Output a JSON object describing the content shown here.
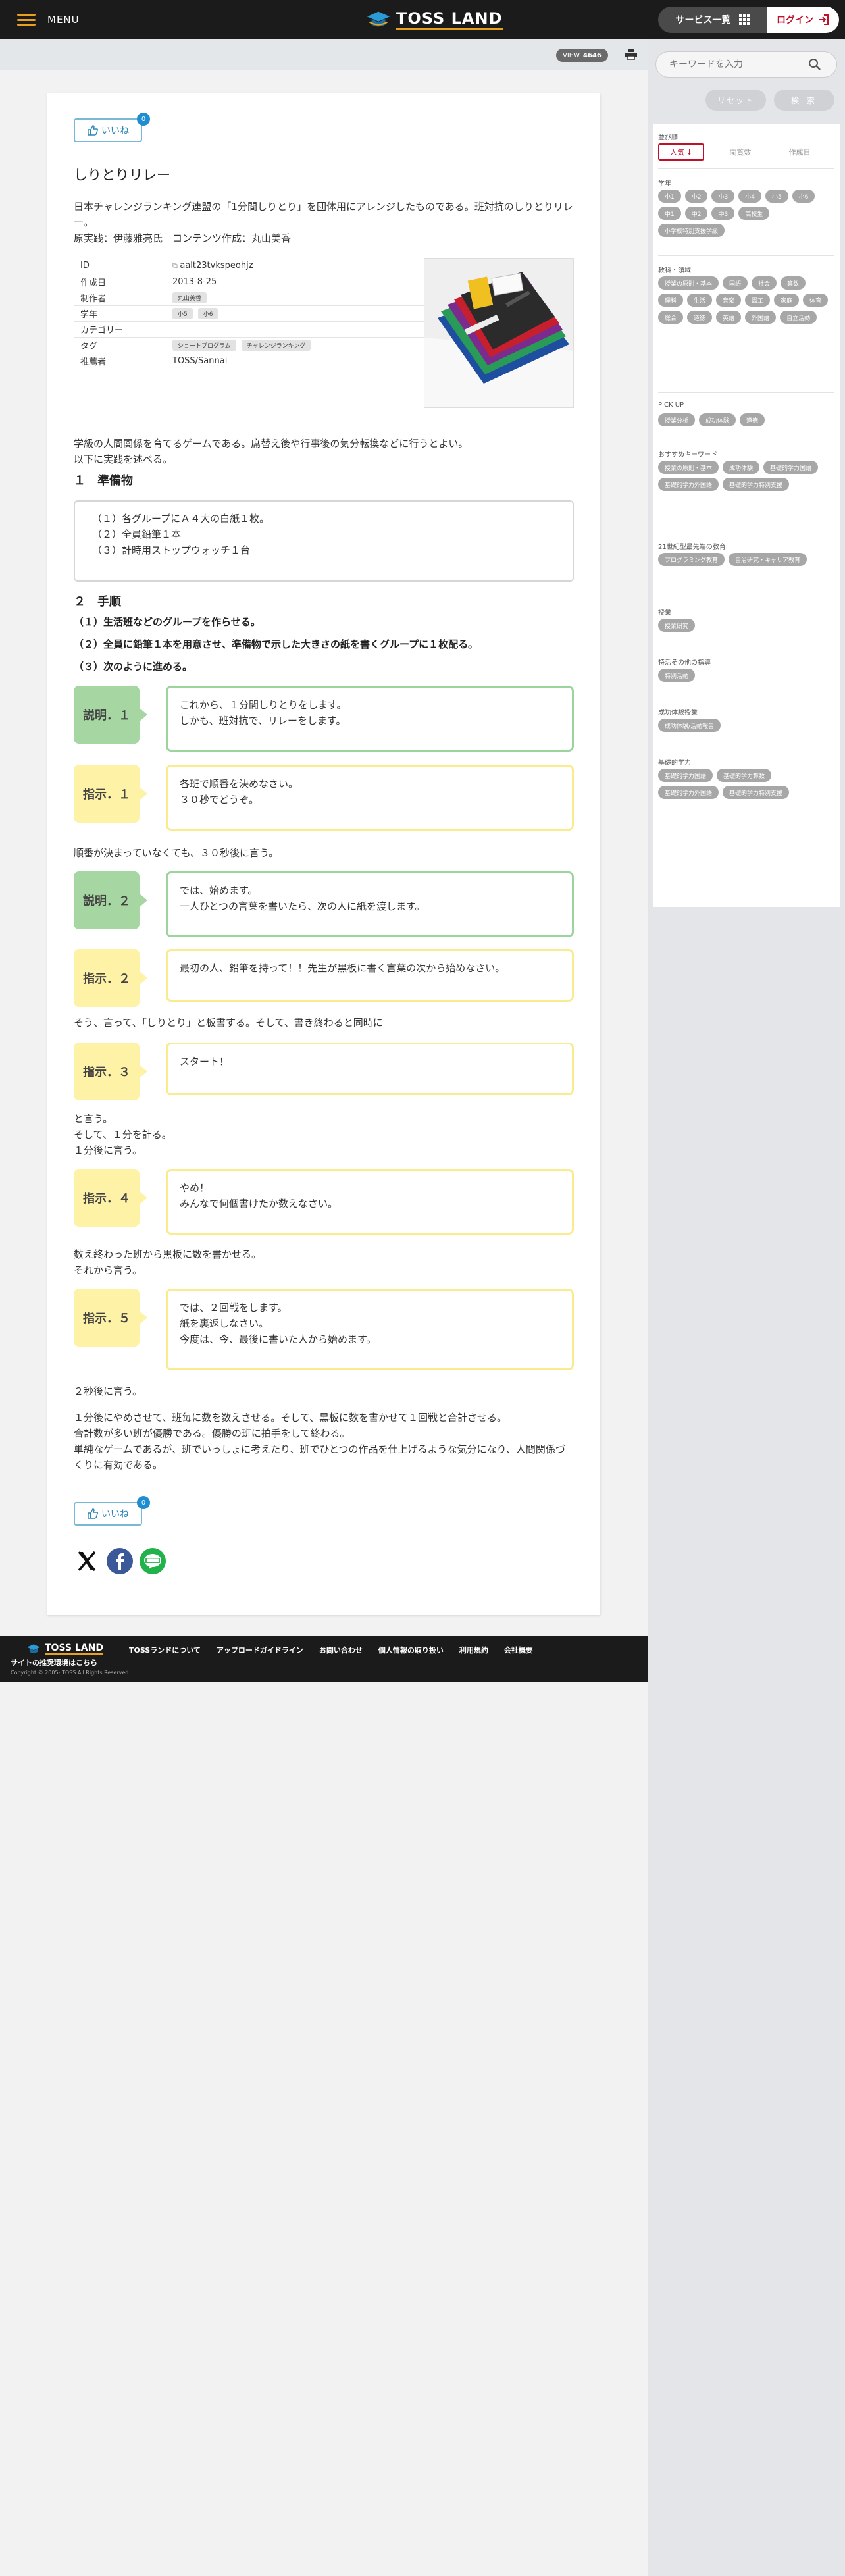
{
  "header": {
    "menu_label": "MENU",
    "logo_text": "TOSS LAND",
    "services_label": "サービス一覧",
    "login_label": "ログイン"
  },
  "subbar": {
    "view_label": "VIEW",
    "view_count": "4646"
  },
  "article": {
    "like_label": "いいね",
    "like_count": "0",
    "title": "しりとりリレー",
    "lead": [
      "日本チャレンジランキング連盟の「1分間しりとり」を団体用にアレンジしたものである。班対抗のしりとりリレー。",
      "原実践：伊藤雅亮氏　コンテンツ作成：丸山美香"
    ],
    "meta": {
      "id_label": "ID",
      "id_value": "aalt23tvkspeohjz",
      "date_label": "作成日",
      "date_value": "2013-8-25",
      "author_label": "制作者",
      "author_value": "丸山美香",
      "grade_label": "学年",
      "grades": [
        "小5",
        "小6"
      ],
      "category_label": "カテゴリー",
      "tag_label": "タグ",
      "tags": [
        "ショートプログラム",
        "チャレンジランキング"
      ],
      "recommender_label": "推薦者",
      "recommender_value": "TOSS/Sannai"
    },
    "intro": [
      "学級の人間関係を育てるゲームである。席替え後や行事後の気分転換などに行うとよい。",
      "以下に実践を述べる。"
    ],
    "prep_heading": "１　準備物",
    "prep_items": [
      "（１）各グループにＡ４大の白紙１枚。",
      "（２）全員鉛筆１本",
      "（３）計時用ストップウォッチ１台"
    ],
    "steps_heading": "２　手順",
    "steps": [
      "（１）生活班などのグループを作らせる。",
      "（２）全員に鉛筆１本を用意させ、準備物で示した大きさの紙を書くグループに１枚配る。",
      "（３）次のように進める。"
    ],
    "blocks": {
      "b1": {
        "tag": "説明．１",
        "lines": [
          "これから、１分間しりとりをします。",
          "しかも、班対抗で、リレーをします。"
        ]
      },
      "b2": {
        "tag": "指示．１",
        "lines": [
          "各班で順番を決めなさい。",
          "３０秒でどうぞ。"
        ]
      },
      "b3": {
        "tag": "説明．２",
        "lines": [
          "では、始めます。",
          "一人ひとつの言葉を書いたら、次の人に紙を渡します。"
        ]
      },
      "b4": {
        "tag": "指示．２",
        "lines": [
          "最初の人、鉛筆を持って！！先生が黒板に書く言葉の次から始めなさい。"
        ]
      },
      "b5": {
        "tag": "指示．３",
        "lines": [
          "スタート！"
        ]
      },
      "b6": {
        "tag": "指示．４",
        "lines": [
          "やめ！",
          "みんなで何個書けたか数えなさい。"
        ]
      },
      "b7": {
        "tag": "指示．５",
        "lines": [
          "では、２回戦をします。",
          "紙を裏返しなさい。",
          "今度は、今、最後に書いた人から始めます。"
        ]
      }
    },
    "mid": {
      "m1": "順番が決まっていなくても、３０秒後に言う。",
      "m2": "そう、言って、「しりとり」と板書する。そして、書き終わると同時に",
      "m3": [
        "と言う。",
        "そして、１分を計る。",
        "１分後に言う。"
      ],
      "m4": [
        "数え終わった班から黒板に数を書かせる。",
        "それから言う。"
      ],
      "m5": "２秒後に言う。",
      "m6": [
        "１分後にやめさせて、班毎に数を数えさせる。そして、黒板に数を書かせて１回戦と合計させる。",
        "合計数が多い班が優勝である。優勝の班に拍手をして終わる。",
        "単純なゲームであるが、班でいっしょに考えたり、班でひとつの作品を仕上げるような気分になり、人間関係づくりに有効である。"
      ]
    }
  },
  "footer": {
    "logo_text": "TOSS LAND",
    "links": [
      "TOSSランドについて",
      "アップロードガイドライン",
      "お問い合わせ",
      "個人情報の取り扱い",
      "利用規約",
      "会社概要"
    ],
    "env": "サイトの推奨環境はこちら",
    "copyright": "Copyright © 2005- TOSS All Rights Reserved."
  },
  "sidebar": {
    "search_placeholder": "キーワードを入力",
    "reset_label": "リセット",
    "search_label": "検 索",
    "sort_label": "並び順",
    "sort": [
      "人気",
      "閲覧数",
      "作成日"
    ],
    "grade_label": "学年",
    "grades": [
      "小1",
      "小2",
      "小3",
      "小4",
      "小5",
      "小6",
      "中1",
      "中2",
      "中3",
      "高校生",
      "小学校特別支援学級"
    ],
    "subject_label": "教科・領域",
    "subjects": [
      "授業の原則・基本",
      "国語",
      "社会",
      "算数",
      "理科",
      "生活",
      "音楽",
      "図工",
      "家庭",
      "体育",
      "総合",
      "道徳",
      "英語",
      "外国語",
      "自立活動"
    ],
    "pickup_label": "PICK UP",
    "pickup": [
      "授業分析",
      "成功体験",
      "道徳"
    ],
    "keyword_label": "おすすめキーワード",
    "keywords": [
      "授業の原則・基本",
      "成功体験",
      "基礎的学力国語",
      "基礎的学力外国語",
      "基礎的学力特別支援"
    ],
    "c21_label": "21世紀型最先端の教育",
    "c21": [
      "プログラミング教育",
      "自治研究・キャリア教育"
    ],
    "class_label": "授業",
    "class_items": [
      "授業研究"
    ],
    "special_label": "特活その他の指導",
    "special_items": [
      "特別活動"
    ],
    "success_label": "成功体験授業",
    "success_items": [
      "成功体験/活動報告"
    ],
    "basic_label": "基礎的学力",
    "basic_items": [
      "基礎的学力国語",
      "基礎的学力算数",
      "基礎的学力外国語",
      "基礎的学力特別支援"
    ]
  }
}
